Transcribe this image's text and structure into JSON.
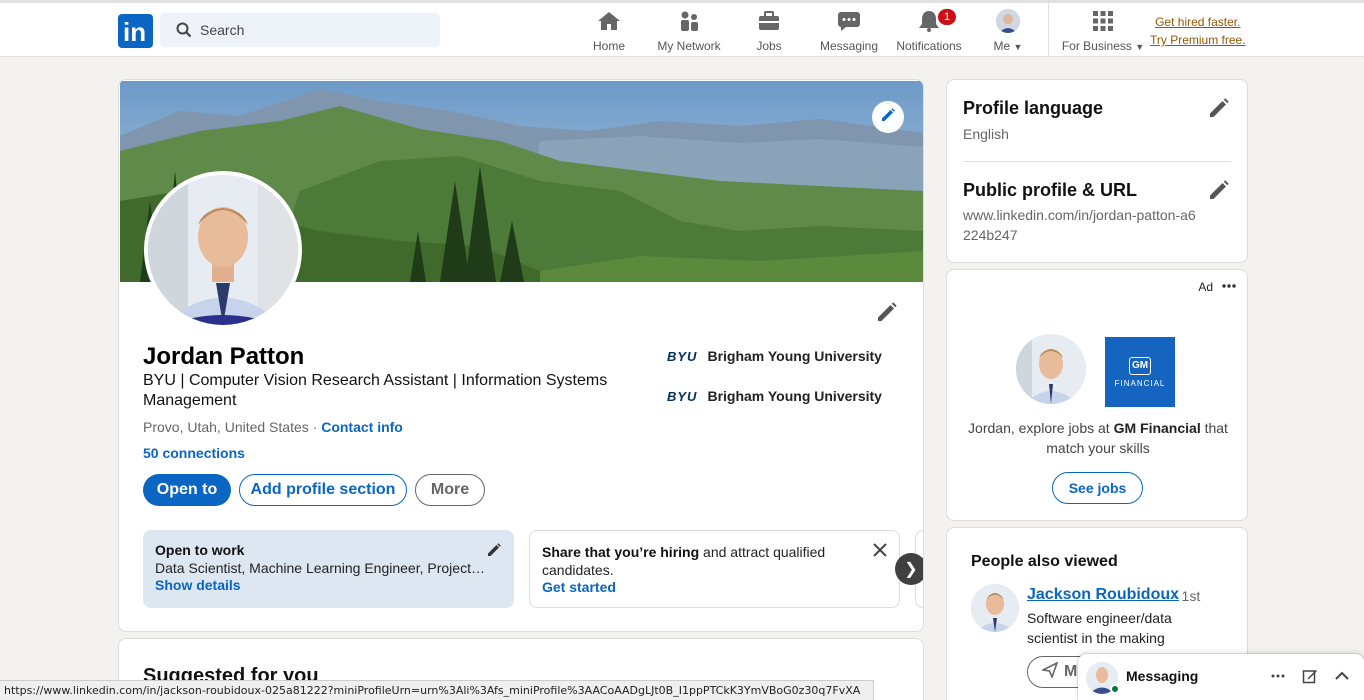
{
  "nav": {
    "search_placeholder": "Search",
    "items": [
      {
        "label": "Home"
      },
      {
        "label": "My Network"
      },
      {
        "label": "Jobs"
      },
      {
        "label": "Messaging"
      },
      {
        "label": "Notifications",
        "badge": "1"
      },
      {
        "label": "Me"
      },
      {
        "label": "For Business"
      }
    ],
    "premium_line1": "Get hired faster.",
    "premium_line2": "Try Premium free."
  },
  "profile": {
    "name": "Jordan Patton",
    "headline": "BYU | Computer Vision Research Assistant | Information Systems Management",
    "location": "Provo, Utah, United States ·",
    "contact_info": "Contact info",
    "connections": "50 connections",
    "education": [
      {
        "logo": "BYU",
        "school": "Brigham Young University"
      },
      {
        "logo": "BYU",
        "school": "Brigham Young University"
      }
    ],
    "buttons": {
      "open_to": "Open to",
      "add_section": "Add profile section",
      "more": "More"
    },
    "open_to_work": {
      "title": "Open to work",
      "roles": "Data Scientist, Machine Learning Engineer, Project …",
      "link": "Show details"
    },
    "hiring": {
      "bold": "Share that you’re hiring",
      "rest": " and attract qualified candidates.",
      "link": "Get started"
    }
  },
  "suggested": {
    "title": "Suggested for you"
  },
  "sidebar": {
    "profile_language": {
      "title": "Profile language",
      "value": "English"
    },
    "public_profile": {
      "title": "Public profile & URL",
      "value": "www.linkedin.com/in/jordan-patton-a6224b247"
    }
  },
  "ad": {
    "label": "Ad",
    "logo_box": "GM",
    "logo_text": "FINANCIAL",
    "text_pre": "Jordan, explore jobs at ",
    "text_company": "GM Financial",
    "text_post": " that match your skills",
    "button": "See jobs"
  },
  "people_also_viewed": {
    "title": "People also viewed",
    "person": {
      "name": "Jackson Roubidoux",
      "degree": "· 1st",
      "headline": "Software engineer/data scientist in the making",
      "button": "Me"
    }
  },
  "messaging_bar": {
    "title": "Messaging"
  },
  "status_url": "https://www.linkedin.com/in/jackson-roubidoux-025a81222?miniProfileUrn=urn%3Ali%3Afs_miniProfile%3AACoAADgLJt0B_I1ppPTCkK3YmVBoG0z30q7FvXA",
  "colors": {
    "brand": "#0a66c2",
    "premium": "#915907",
    "badge": "#cc1016",
    "gm_blue": "#1565c0"
  }
}
